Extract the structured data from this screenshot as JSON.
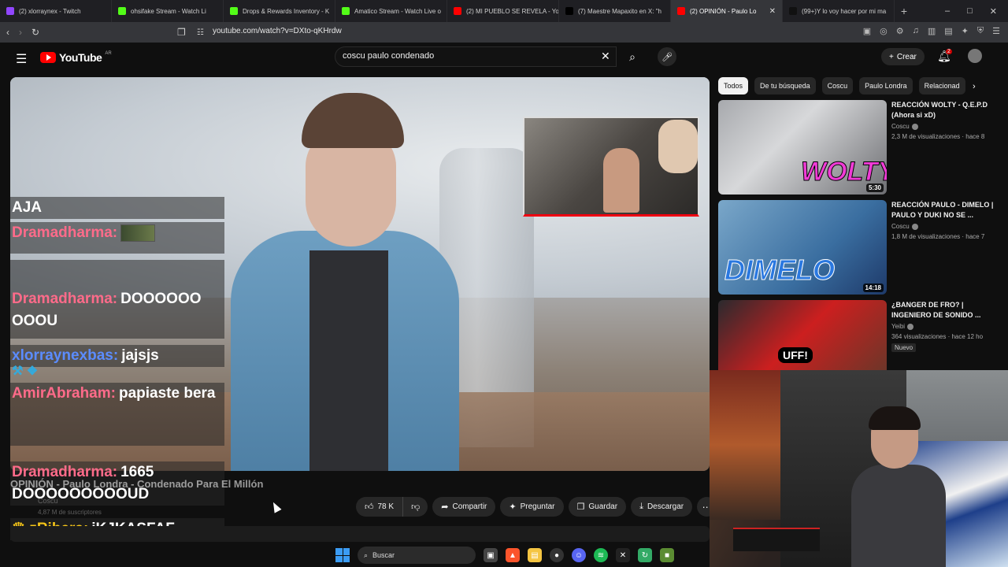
{
  "browser": {
    "tabs": [
      {
        "title": "(2) xlorraynex - Twitch",
        "favicon_color": "#9146ff",
        "active": false
      },
      {
        "title": "ohsifake Stream - Watch Li",
        "favicon_color": "#53fc18",
        "active": false
      },
      {
        "title": "Drops & Rewards Inventory - K",
        "favicon_color": "#53fc18",
        "active": false
      },
      {
        "title": "Amatico Stream - Watch Live o",
        "favicon_color": "#53fc18",
        "active": false
      },
      {
        "title": "(2) MI PUEBLO SE REVELA - Yo",
        "favicon_color": "#ff0000",
        "active": false
      },
      {
        "title": "(7) Maestre Mapaxito en X: \"h",
        "favicon_color": "#000000",
        "active": false
      },
      {
        "title": "(2) OPINIÓN - Paulo Lo",
        "favicon_color": "#ff0000",
        "active": true
      },
      {
        "title": "(99+)Y lo voy hacer por mi ma",
        "favicon_color": "#111111",
        "active": false
      }
    ],
    "url": "youtube.com/watch?v=DXto-qKHrdw"
  },
  "youtube": {
    "logo_text": "YouTube",
    "country_code": "AR",
    "search_query": "coscu paulo condenado",
    "create_label": "Crear",
    "notification_count": "2"
  },
  "chat": [
    {
      "user": "",
      "message": "AJA",
      "user_color": "#ffffff"
    },
    {
      "user": "Dramadharma:",
      "message": "",
      "user_color": "#ff6b8a",
      "emote": true
    },
    {
      "user": "Dramadharma:",
      "message": "DOOOOOO OOOU",
      "user_color": "#ff6b8a"
    },
    {
      "user": "xlorraynexbas:",
      "message": "jajsjs",
      "user_color": "#5b8cff"
    },
    {
      "user": "AmirAbraham:",
      "message": "papiaste bera",
      "user_color": "#ff6b8a"
    },
    {
      "user": "Dramadharma:",
      "message": "1665 DOOOOOOOOOUD",
      "user_color": "#ff6b8a"
    },
    {
      "user": "zRibera:",
      "message": "jKJKASFAF",
      "user_color": "#f5c518"
    }
  ],
  "video": {
    "title": "OPINIÓN - Paulo Londra - Condenado Para El Millón",
    "channel": "Coscu",
    "subscribers": "4,87 M de suscriptores",
    "likes": "78 K",
    "share_label": "Compartir",
    "ask_label": "Preguntar",
    "save_label": "Guardar",
    "download_label": "Descargar"
  },
  "chips": [
    "Todos",
    "De tu búsqueda",
    "Coscu",
    "Paulo Londra",
    "Relacionad"
  ],
  "recommendations": [
    {
      "title": "REACCIÓN WOLTY - Q.E.P.D (Ahora si xD)",
      "channel": "Coscu",
      "meta": "2,3 M de visualizaciones · hace 8",
      "duration": "5:30",
      "thumb_text": "WOLTY",
      "badge": ""
    },
    {
      "title": "REACCIÓN PAULO - DIMELO | PAULO Y DUKI NO SE ...",
      "channel": "Coscu",
      "meta": "1,8 M de visualizaciones · hace 7",
      "duration": "14:18",
      "thumb_text": "DIMELO",
      "badge": ""
    },
    {
      "title": "¿BANGER DE FRO? | INGENIERO DE SONIDO ...",
      "channel": "Yeibi",
      "meta": "364 visualizaciones · hace 12 ho",
      "duration": "",
      "thumb_text": "UFF!",
      "badge": "Nuevo"
    }
  ],
  "taskbar": {
    "search_placeholder": "Buscar"
  }
}
